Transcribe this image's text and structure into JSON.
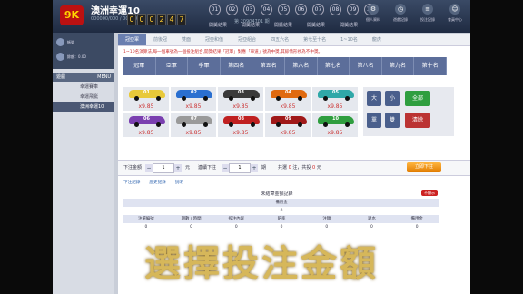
{
  "header": {
    "logo": "9K",
    "title": "澳洲幸運10",
    "countdown": [
      "0",
      "0",
      "0",
      "2",
      "4",
      "7"
    ],
    "user_info": "000000/000 / 0000000",
    "balls": [
      "01",
      "02",
      "03",
      "04",
      "05",
      "06",
      "07",
      "08",
      "09",
      "10"
    ],
    "draw_info": "第 20904701 期",
    "links": [
      "開獎結果",
      "開獎結果",
      "開獎結果",
      "開獎結果",
      "開獎結果"
    ],
    "icons": [
      {
        "icon": "gear-icon",
        "label": "個人資料"
      },
      {
        "icon": "clock-icon",
        "label": "遊戲記錄"
      },
      {
        "icon": "list-icon",
        "label": "投注記錄"
      },
      {
        "icon": "user-icon",
        "label": "會員中心"
      },
      {
        "icon": "logout-icon",
        "label": "退出"
      }
    ]
  },
  "sidebar": {
    "user_label": "帳號",
    "balance_label": "餘額：0.00",
    "section": "遊戲",
    "section_right": "MENU",
    "items": [
      "幸運賽車",
      "幸運飛艇",
      "澳洲幸運10"
    ]
  },
  "tabs": [
    "冠亞軍",
    "前後冠",
    "雙面",
    "冠亞和值",
    "冠亞組合",
    "四五六名",
    "第七至十名",
    "1~10名",
    "龍虎"
  ],
  "rule_text": "1~10名演算法,每一個車號為一個投注組合,開獎結果「冠軍」對應「車道」號為中獎,其餘情形視為不中獎。",
  "rank_headers": [
    "冠軍",
    "亞軍",
    "季軍",
    "第四名",
    "第五名",
    "第六名",
    "第七名",
    "第八名",
    "第九名",
    "第十名"
  ],
  "cars": [
    {
      "num": "01",
      "color": "#e8c93a",
      "odds": "x9.85"
    },
    {
      "num": "02",
      "color": "#2a6fd0",
      "odds": "x9.85"
    },
    {
      "num": "03",
      "color": "#3a3a3a",
      "odds": "x9.85"
    },
    {
      "num": "04",
      "color": "#e06a10",
      "odds": "x9.85"
    },
    {
      "num": "05",
      "color": "#2fa8a8",
      "odds": "x9.85"
    },
    {
      "num": "06",
      "color": "#7a3fb0",
      "odds": "x9.85"
    },
    {
      "num": "07",
      "color": "#9a9a9a",
      "odds": "x9.85"
    },
    {
      "num": "08",
      "color": "#c02020",
      "odds": "x9.85"
    },
    {
      "num": "09",
      "color": "#a01818",
      "odds": "x9.85"
    },
    {
      "num": "10",
      "color": "#2f9e3f",
      "odds": "x9.85"
    }
  ],
  "pad": {
    "big": "大",
    "small": "小",
    "odd": "單",
    "even": "雙",
    "all": "全部",
    "clear": "清除"
  },
  "bet": {
    "amount_label": "下注金額",
    "amount": "1",
    "unit": "元",
    "chase_label": "連續下注",
    "chase": "1",
    "period_unit": "期",
    "total_prefix": "共選",
    "total_count": "0",
    "total_mid": "注，共投",
    "total_amount": "0",
    "total_suffix": "元",
    "submit": "立即下注"
  },
  "record_links": [
    "下注記錄",
    "歷史記錄",
    "說明"
  ],
  "record_title": "未結算金額記錄",
  "record_close": "不顯示",
  "record_sub": "備用金",
  "record_sub_value": "0",
  "record_headers": [
    "注單編號",
    "期數 / 時間",
    "投注內容",
    "賠率",
    "注額",
    "退水",
    "備用金"
  ],
  "record_values": [
    "0",
    "0",
    "0",
    "0",
    "0",
    "0",
    "0"
  ],
  "caption": "選擇投注金額"
}
